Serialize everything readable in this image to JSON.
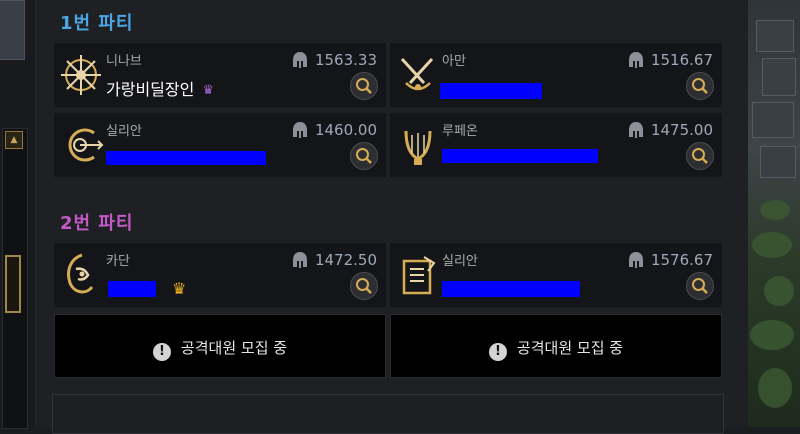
{
  "party1": {
    "title": "1번 파티",
    "members": [
      {
        "class": "니나브",
        "name": "가랑비딜장인",
        "gear_score": "1563.33",
        "crown": "purple",
        "class_icon": "ninav-emblem-icon"
      },
      {
        "class": "아만",
        "name": "",
        "gear_score": "1516.67",
        "crown": "",
        "class_icon": "aman-emblem-icon"
      },
      {
        "class": "실리안",
        "name": "",
        "gear_score": "1460.00",
        "crown": "",
        "class_icon": "silian-emblem-icon"
      },
      {
        "class": "루페온",
        "name": "",
        "gear_score": "1475.00",
        "crown": "",
        "class_icon": "lupeon-emblem-icon"
      }
    ]
  },
  "party2": {
    "title": "2번 파티",
    "members": [
      {
        "class": "카단",
        "name": "",
        "gear_score": "1472.50",
        "crown": "gold",
        "class_icon": "kadan-emblem-icon"
      },
      {
        "class": "실리안",
        "name": "",
        "gear_score": "1576.67",
        "crown": "",
        "class_icon": "silian-card-emblem-icon"
      }
    ],
    "recruit_slots": [
      {
        "label": "공격대원 모집 중"
      },
      {
        "label": "공격대원 모집 중"
      }
    ]
  },
  "icons": {
    "gear_score": "helmet-icon",
    "inspect": "magnifier-icon",
    "recruit": "exclamation-icon",
    "leader": "crown-icon"
  },
  "colors": {
    "party1_title": "#4aa6e4",
    "party2_title": "#c35ac7",
    "gold": "#d6ad55",
    "leader_crown": "#f0b41e",
    "purple_crown": "#a46cd6"
  }
}
